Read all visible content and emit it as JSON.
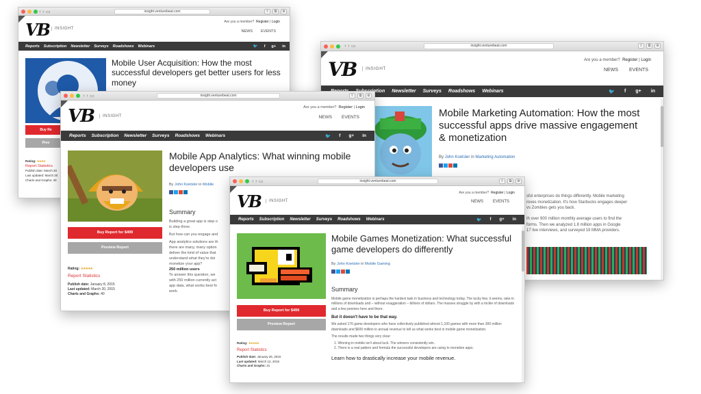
{
  "browser": {
    "url": "insight.venturebeat.com"
  },
  "site": {
    "logo_vb": "VB",
    "insight": "INSIGHT",
    "member_prompt": "Are you a member?",
    "register": "Register",
    "login": "Login",
    "news": "NEWS",
    "events": "EVENTS",
    "nav": [
      "Reports",
      "Subscription",
      "Newsletter",
      "Surveys",
      "Roadshows",
      "Webinars"
    ],
    "social": [
      "𝕥",
      "f",
      "g+",
      "in"
    ]
  },
  "reports": {
    "user_acquisition": {
      "title": "Mobile User Acquisition: How the most successful developers get better users for less money",
      "buy_label": "Buy Re",
      "preview_label": "Prev",
      "rating_label": "Rating:",
      "stats_label": "Report Statistics",
      "publish_date": "Publish date: March 20",
      "last_updated": "Last updated: March 20",
      "charts": "Charts and Graphs: 40"
    },
    "marketing_automation": {
      "title": "Mobile Marketing Automation: How the most successful apps drive massive engagement & monetization",
      "byline_prefix": "By",
      "author": "John Koetsler",
      "in": "in",
      "category": "Marketing Automation",
      "body": [
        "sful enterprises do things differently. Mobile marketing",
        "roves monetization. It's how Starbucks engages deeper",
        "vs Zombies gets you back.",
        "th over 900 million monthly average users to find the",
        "forms. Then we analyzed 1.8 million apps in Google",
        "17 live interviews, and surveyed 19 MMA providers."
      ]
    },
    "app_analytics": {
      "title": "Mobile App Analytics: What winning mobile developers use",
      "byline_prefix": "By",
      "author": "John Koetsler",
      "in": "in",
      "category": "Mobile",
      "summary": "Summary",
      "body": [
        "Building a great app is step o",
        "is step three.",
        "But how can you engage and",
        "App analytics solutions are th",
        "there are many, many option",
        "deliver the kind of value that",
        "understand what they're doi",
        "monetize your app?"
      ],
      "subhead": "250 million users",
      "body2": [
        "To answer this question, we",
        "with 250 million currently act",
        "app data, what works best fo",
        "work."
      ],
      "buy_label": "Buy Report for $499",
      "preview_label": "Preview Report",
      "rating_label": "Rating:",
      "stats_label": "Report Statistics",
      "publish_date_label": "Publish date:",
      "publish_date": "January 8, 2015",
      "last_updated_label": "Last updated:",
      "last_updated": "March 20, 2015",
      "charts_label": "Charts and Graphs:",
      "charts": "40"
    },
    "games_monetization": {
      "title": "Mobile Games Monetization: What successful game developers do differently",
      "byline_prefix": "By",
      "author": "John Koetsler",
      "in": "in",
      "category": "Mobile Gaming",
      "summary": "Summary",
      "para1": "Mobile game monetization is perhaps the hardest task in business and technology today. The lucky few, it seems, rake in millions of downloads and – without exaggeration – billions of dollars. The masses struggle by with a trickle of downloads and a few pennies here and there.",
      "subhead": "But it doesn't have to be that way.",
      "para2": "We asked 176 game developers who have collectively published almost 1,100 games with more than 300 million downloads and $600 million in annual revenue to tell us what works best in mobile game monetization.",
      "para3": "The results made two things very clear:",
      "list": [
        "1. Winning in mobile isn't about luck. The winners consistently win.",
        "2. There is a real pattern and formula the successful developers are using to monetize apps."
      ],
      "cta": "Learn how to drastically increase your mobile revenue.",
      "buy_label": "Buy Report for $499",
      "preview_label": "Preview Report",
      "rating_label": "Rating:",
      "stats_label": "Report Statistics",
      "publish_date_label": "Publish date:",
      "publish_date": "January 26, 2015",
      "last_updated_label": "Last updated:",
      "last_updated": "March 12, 2015",
      "charts_label": "Charts and Graphs:",
      "charts": "31"
    }
  },
  "colors": {
    "brand_red": "#e0292e",
    "nav_dark": "#3a3a3a",
    "link_blue": "#2a6db5"
  }
}
